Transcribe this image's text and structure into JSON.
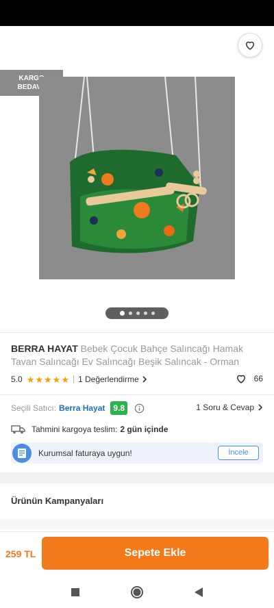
{
  "badge": {
    "line1": "KARGO",
    "line2": "BEDAVA"
  },
  "gallery": {
    "total": 5,
    "active": 0
  },
  "product": {
    "brand": "BERRA HAYAT",
    "name": "Bebek Çocuk Bahçe Salıncağı Hamak Tavan Salıncağı Ev Salıncağı Beşik Salıncak - Orman",
    "rating": "5.0",
    "stars": 5,
    "reviews": "1 Değerlendirme",
    "favorites": "66"
  },
  "seller": {
    "label": "Seçili Satıcı:",
    "name": "Berra Hayat",
    "score": "9.8",
    "qa": "1 Soru & Cevap"
  },
  "delivery": {
    "label": "Tahmini kargoya teslim:",
    "value": "2 gün içinde"
  },
  "invoice": {
    "text": "Kurumsal faturaya uygun!",
    "button": "İncele"
  },
  "campaigns": {
    "title": "Ürünün Kampanyaları"
  },
  "footer": {
    "price": "259 TL",
    "cart_button": "Sepete Ekle"
  },
  "colors": {
    "accent": "#f27a1a",
    "seller_link": "#1e6fbd",
    "score_green": "#2bb24c",
    "star": "#ff9a00",
    "info_blue": "#4b8fe0"
  },
  "icons": [
    "back-arrow-icon",
    "share-icon",
    "heart-icon",
    "star-icon",
    "chevron-right-icon",
    "info-icon",
    "truck-icon",
    "invoice-icon",
    "square-icon",
    "circle-icon",
    "triangle-back-icon"
  ]
}
